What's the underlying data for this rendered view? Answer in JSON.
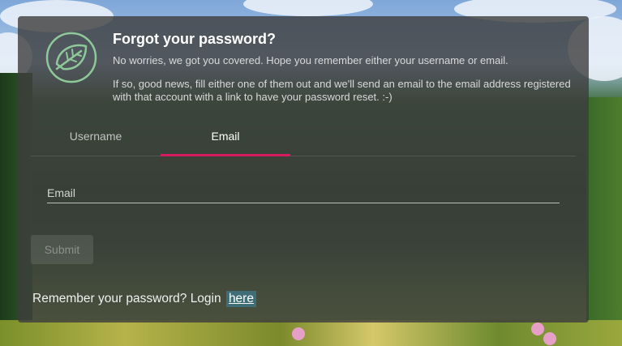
{
  "header": {
    "title": "Forgot your password?",
    "subtitle": "No worries, we got you covered. Hope you remember either your username or email.",
    "description": "If so, good news, fill either one of them out and we'll send an email to the email address registered with that account with a link to have your password reset. :-)"
  },
  "tabs": [
    {
      "label": "Username",
      "active": false
    },
    {
      "label": "Email",
      "active": true
    }
  ],
  "form": {
    "email_label": "Email",
    "email_value": "",
    "submit_label": "Submit"
  },
  "footer": {
    "remember_text": "Remember your password? Login",
    "link_label": "here"
  },
  "icons": {
    "logo": "leaf-icon"
  },
  "colors": {
    "accent": "#d81b60",
    "card_background": "#3c3c3c",
    "logo_green": "#8fc99a",
    "link_highlight": "#3f6e78"
  }
}
